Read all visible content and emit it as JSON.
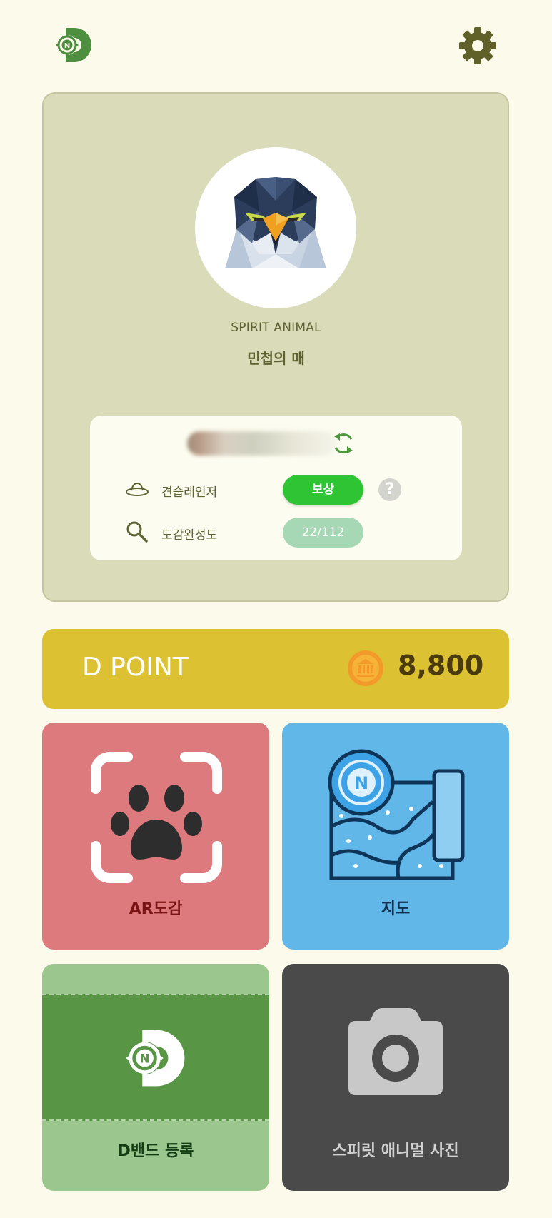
{
  "header": {
    "logo_icon": "d-band-logo-icon",
    "settings_icon": "gear-icon"
  },
  "profile": {
    "spirit_label": "SPIRIT ANIMAL",
    "spirit_name": "민첩의 매",
    "avatar_icon": "falcon-avatar-icon",
    "refresh_icon": "refresh-icon",
    "rank_label": "견습레인저",
    "reward_button": "보상",
    "help_button": "?",
    "collection_label": "도감완성도",
    "collection_progress": "22/112"
  },
  "dpoint": {
    "label": "D POINT",
    "value": "8,800",
    "coin_icon": "coin-icon"
  },
  "tiles": {
    "ar": {
      "label": "AR도감",
      "icon": "paw-scan-icon"
    },
    "map": {
      "label": "지도",
      "icon": "map-icon"
    },
    "band": {
      "label": "D밴드 등록",
      "icon": "d-band-logo-icon"
    },
    "photo": {
      "label": "스피릿 애니멀 사진",
      "icon": "camera-icon"
    }
  },
  "colors": {
    "background": "#fcfaea",
    "profile_card": "#dadbb8",
    "reward": "#2ec433",
    "dpoint": "#dcc133",
    "ar_tile": "#dd7a7d",
    "map_tile": "#62b7e9",
    "band_tile": "#9bc68e",
    "photo_tile": "#4a4a4a"
  }
}
